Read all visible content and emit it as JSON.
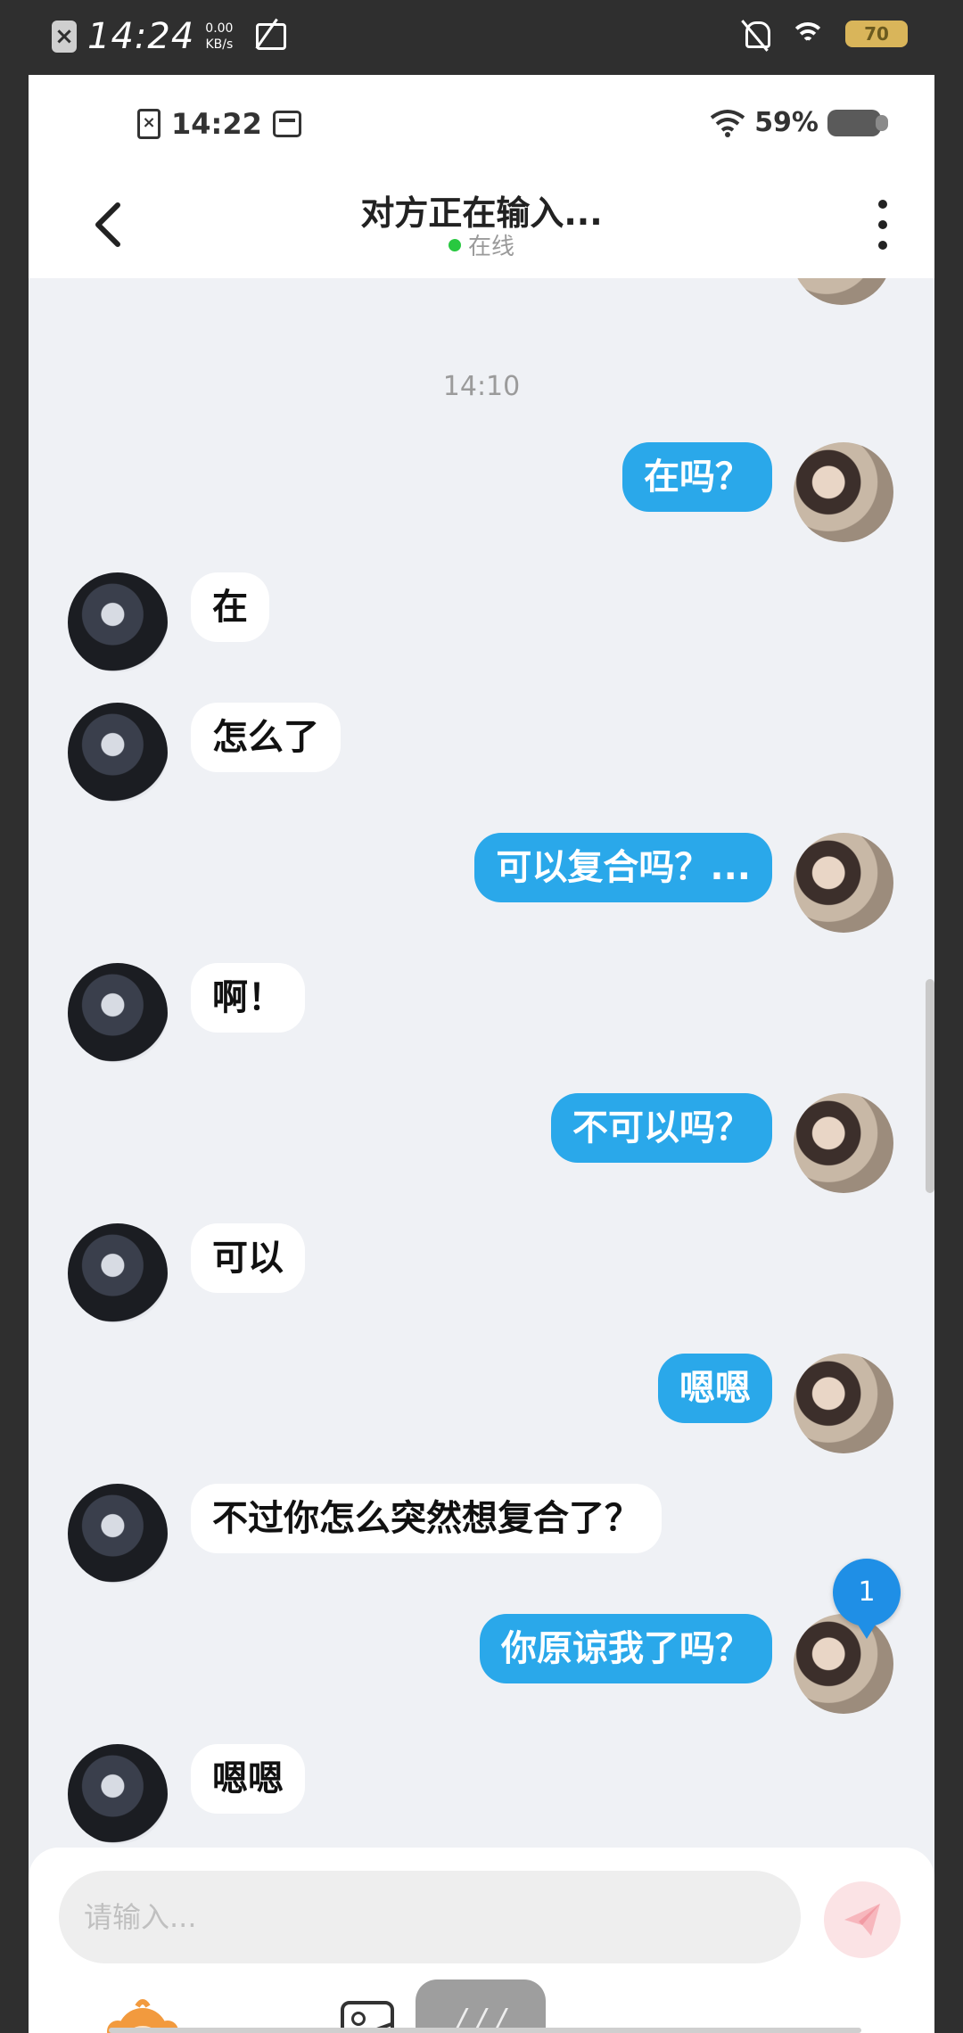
{
  "outer_status": {
    "time": "14:24",
    "net_speed_value": "0.00",
    "net_speed_unit": "KB/s",
    "battery": "70"
  },
  "inner_status": {
    "time": "14:22",
    "battery_percent": "59%"
  },
  "header": {
    "title": "对方正在输入...",
    "online_label": "在线"
  },
  "chat": {
    "time_separator": "14:10",
    "messages": [
      {
        "dir": "out",
        "text": "在吗？"
      },
      {
        "dir": "in",
        "text": "在"
      },
      {
        "dir": "in",
        "text": "怎么了"
      },
      {
        "dir": "out",
        "text": "可以复合吗？..."
      },
      {
        "dir": "in",
        "text": "啊！"
      },
      {
        "dir": "out",
        "text": "不可以吗？"
      },
      {
        "dir": "in",
        "text": "可以"
      },
      {
        "dir": "out",
        "text": "嗯嗯"
      },
      {
        "dir": "in",
        "text": "不过你怎么突然想复合了？"
      },
      {
        "dir": "out",
        "text": "你原谅我了吗？"
      },
      {
        "dir": "in",
        "text": "嗯嗯"
      }
    ],
    "unread_badge": "1"
  },
  "input": {
    "placeholder": "请输入...",
    "grey_button_label": "/ / /"
  },
  "colors": {
    "outgoing_bubble": "#2aa8ea",
    "incoming_bubble": "#ffffff",
    "chat_background": "#eff1f5",
    "online_dot": "#28c840"
  }
}
